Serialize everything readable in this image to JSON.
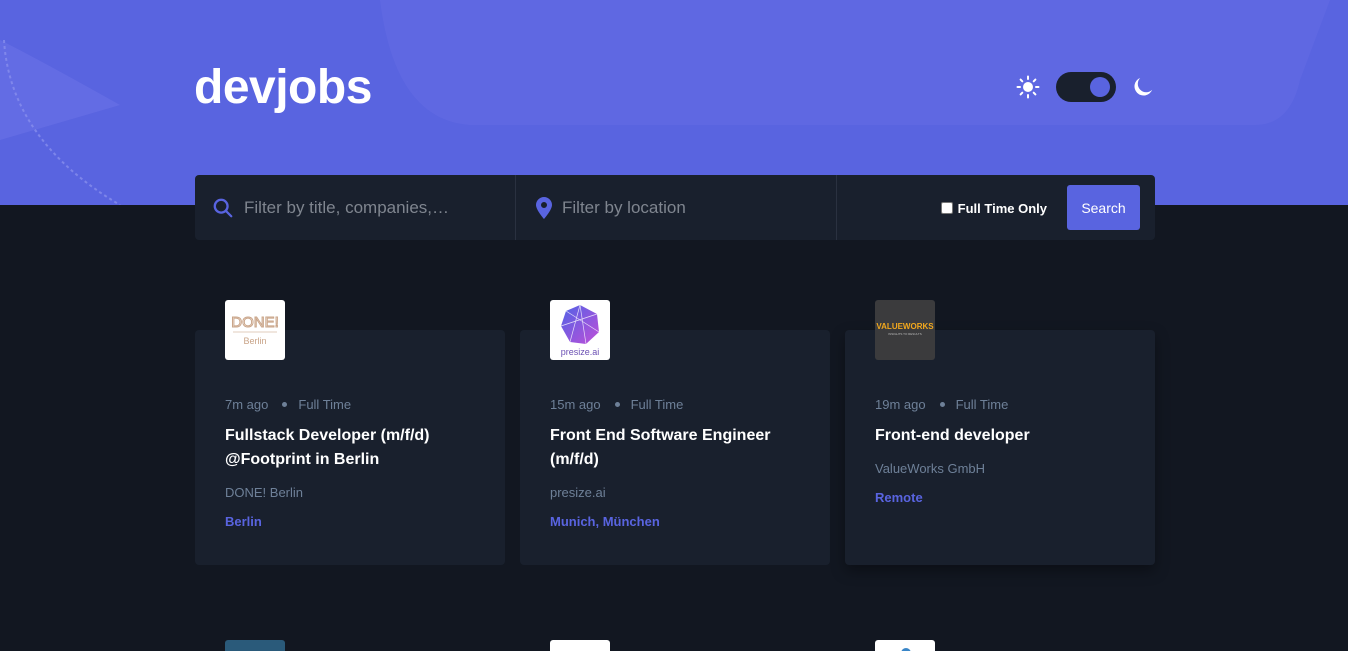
{
  "header": {
    "brand": "devjobs",
    "theme_toggle": {
      "mode": "dark"
    }
  },
  "search": {
    "title_placeholder": "Filter by title, companies,…",
    "location_placeholder": "Filter by location",
    "fulltime_label": "Full Time Only",
    "fulltime_checked": false,
    "button_label": "Search"
  },
  "jobs": [
    {
      "posted": "7m ago",
      "contract": "Full Time",
      "title": "Fullstack Developer (m/f/d) @Footprint in Berlin",
      "company": "DONE! Berlin",
      "location": "Berlin",
      "logo_text": "DONE!",
      "logo_subtext": "Berlin"
    },
    {
      "posted": "15m ago",
      "contract": "Full Time",
      "title": "Front End Software Engineer (m/f/d)",
      "company": "presize.ai",
      "location": "Munich, München",
      "logo_text": "presize.ai"
    },
    {
      "posted": "19m ago",
      "contract": "Full Time",
      "title": "Front-end developer",
      "company": "ValueWorks GmbH",
      "location": "Remote",
      "logo_text": "VALUEWORKS",
      "logo_subtext": "INSIGHTS TO RESULTS"
    }
  ],
  "colors": {
    "accent": "#5964e0",
    "background": "#121721",
    "card": "#19202d",
    "muted_text": "#6e8098"
  }
}
